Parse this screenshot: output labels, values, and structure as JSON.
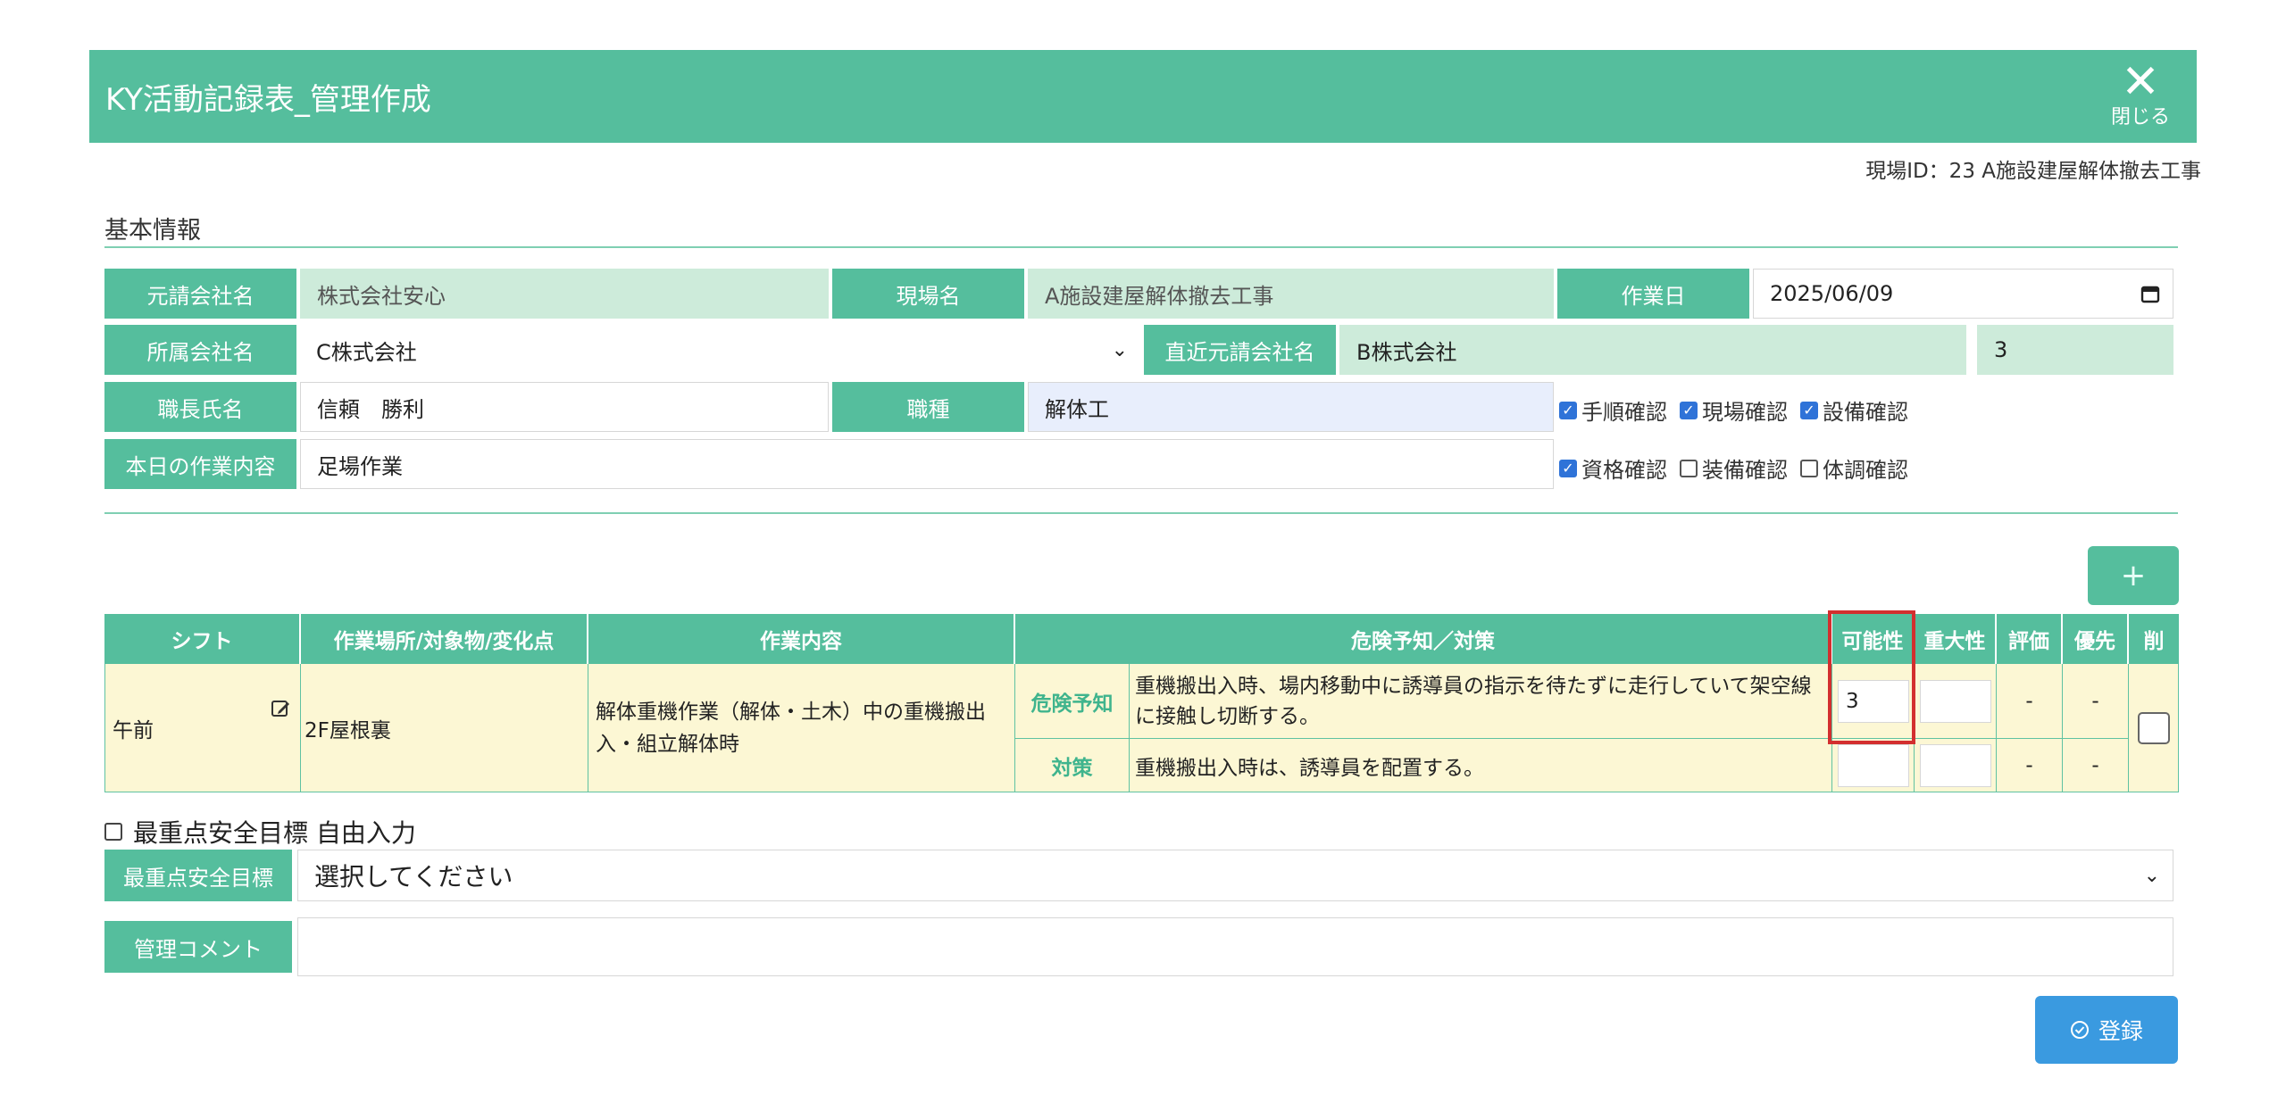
{
  "header": {
    "title": "KY活動記録表_管理作成",
    "close_label": "閉じる"
  },
  "site_id_text": "現場ID：23 A施設建屋解体撤去工事",
  "basic_info": {
    "section_title": "基本情報",
    "prime_contractor_label": "元請会社名",
    "prime_contractor_value": "株式会社安心",
    "site_name_label": "現場名",
    "site_name_value": "A施設建屋解体撤去工事",
    "work_date_label": "作業日",
    "work_date_value": "2025/06/09",
    "affiliated_company_label": "所属会社名",
    "affiliated_company_value": "C株式会社",
    "direct_prime_label": "直近元請会社名",
    "direct_prime_value": "B株式会社",
    "direct_prime_number": "3",
    "foreman_label": "職長氏名",
    "foreman_value": "信頼　勝利",
    "trade_label": "職種",
    "trade_value": "解体工",
    "today_work_label": "本日の作業内容",
    "today_work_value": "足場作業",
    "checks_row1": [
      {
        "label": "手順確認",
        "checked": true
      },
      {
        "label": "現場確認",
        "checked": true
      },
      {
        "label": "設備確認",
        "checked": true
      }
    ],
    "checks_row2": [
      {
        "label": "資格確認",
        "checked": true
      },
      {
        "label": "装備確認",
        "checked": false
      },
      {
        "label": "体調確認",
        "checked": false
      }
    ]
  },
  "add_button_label": "+",
  "table": {
    "headers": {
      "shift": "シフト",
      "place": "作業場所/対象物/変化点",
      "content": "作業内容",
      "hazard": "危険予知／対策",
      "possibility": "可能性",
      "severity": "重大性",
      "evaluation": "評価",
      "priority": "優先",
      "delete": "削"
    },
    "row": {
      "shift": "午前",
      "place": "2F屋根裏",
      "content": "解体重機作業（解体・土木）中の重機搬出入・組立解体時",
      "hazard_label": "危険予知",
      "hazard_text": "重機搬出入時、場内移動中に誘導員の指示を待たずに走行していて架空線に接触し切断する。",
      "possibility_value": "3",
      "hazard_eval": "-",
      "hazard_priority": "-",
      "measure_label": "対策",
      "measure_text": "重機搬出入時は、誘導員を配置する。",
      "measure_eval": "-",
      "measure_priority": "-"
    }
  },
  "free_input_label": "最重点安全目標 自由入力",
  "safety_goal_label": "最重点安全目標",
  "safety_goal_value": "選択してください",
  "comment_label": "管理コメント",
  "register_label": "登録",
  "colors": {
    "accent": "#55be9d",
    "register": "#3a9ae0",
    "highlight": "#d32f2f"
  }
}
